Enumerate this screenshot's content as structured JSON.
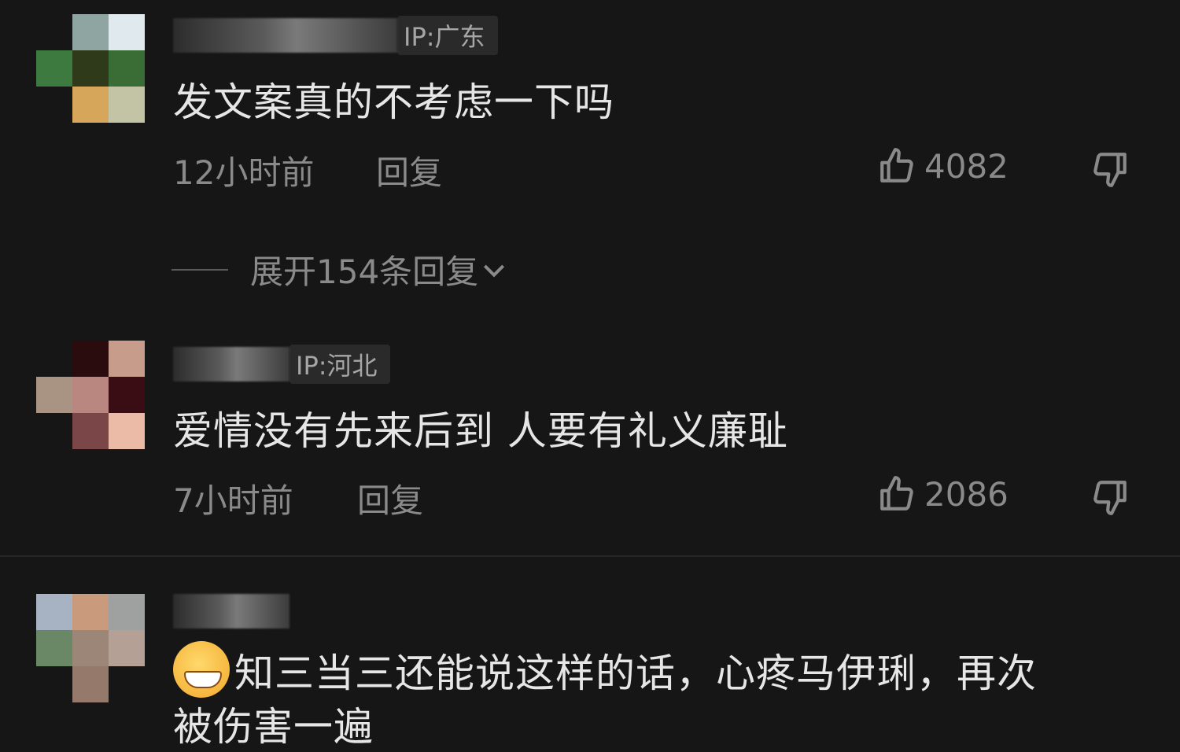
{
  "comments": [
    {
      "ip": "IP:广东",
      "text": "发文案真的不考虑一下吗",
      "time": "12小时前",
      "reply": "回复",
      "likes": "4082",
      "expand": "展开154条回复",
      "avatar_colors": [
        "#161616",
        "#8fa5a1",
        "#dfe9ee",
        "#3d7a3f",
        "#2e3a19",
        "#3a6d36",
        "#161616",
        "#d6a65b",
        "#c3c3a6"
      ]
    },
    {
      "ip": "IP:河北",
      "text": "爱情没有先来后到 人要有礼义廉耻",
      "time": "7小时前",
      "reply": "回复",
      "likes": "2086",
      "avatar_colors": [
        "#161616",
        "#2a0c0e",
        "#c79c8a",
        "#a99484",
        "#b98780",
        "#3a0c14",
        "#161616",
        "#7a4647",
        "#ebbba8"
      ]
    },
    {
      "text_line1": "知三当三还能说这样的话，心疼马伊琍，再次",
      "text_line2": "被伤害一遍",
      "emoji": "grimacing-sweat-emoji",
      "avatar_colors": [
        "#a7b3c3",
        "#c99a7b",
        "#9ea1a0",
        "#6a8766",
        "#9b8677",
        "#b5a095",
        "#161616",
        "#95796a",
        "#161616"
      ]
    }
  ],
  "colors": {
    "background": "#161616",
    "text": "#e6e6e6",
    "muted": "#8a8a8a"
  }
}
